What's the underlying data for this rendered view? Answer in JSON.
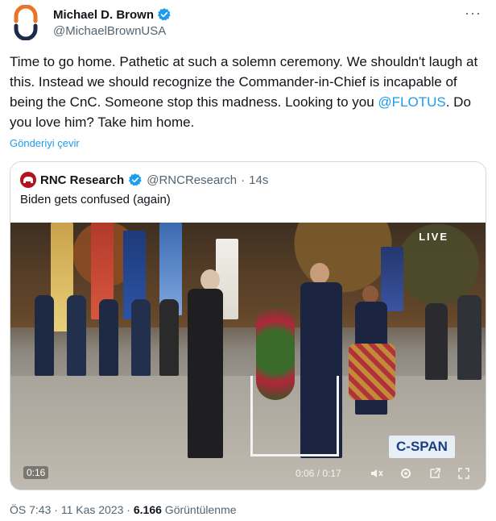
{
  "tweet": {
    "author_name": "Michael D. Brown",
    "author_handle": "@MichaelBrownUSA",
    "text_part1": "Time to go home.  Pathetic at such a solemn ceremony.  We shouldn't laugh at this.  Instead we should recognize the Commander-in-Chief is incapable of being the CnC.  Someone stop this madness.  Looking to you ",
    "mention": "@FLOTUS",
    "text_part2": ".  Do you love him?  Take him home.",
    "translate_link": "Gönderiyi çevir",
    "more_icon": "more-dots-icon"
  },
  "quote": {
    "name": "RNC Research",
    "handle": "@RNCResearch",
    "separator": "·",
    "time": "14s",
    "text": "Biden gets confused (again)",
    "video": {
      "live_label": "LIVE",
      "network_logo": "C-SPAN",
      "elapsed": "0:16",
      "player_time": "0:06 / 0:17"
    }
  },
  "meta": {
    "time": "ÖS 7:43",
    "sep1": " · ",
    "date": "11 Kas 2023",
    "sep2": " · ",
    "views_count": "6.166",
    "views_label": " Görüntülenme"
  },
  "colors": {
    "link": "#1d9bf0",
    "verified": "#1d9bf0",
    "secondary_text": "#536471",
    "avatar_orange": "#e8732a",
    "avatar_navy": "#1c2b4a"
  }
}
